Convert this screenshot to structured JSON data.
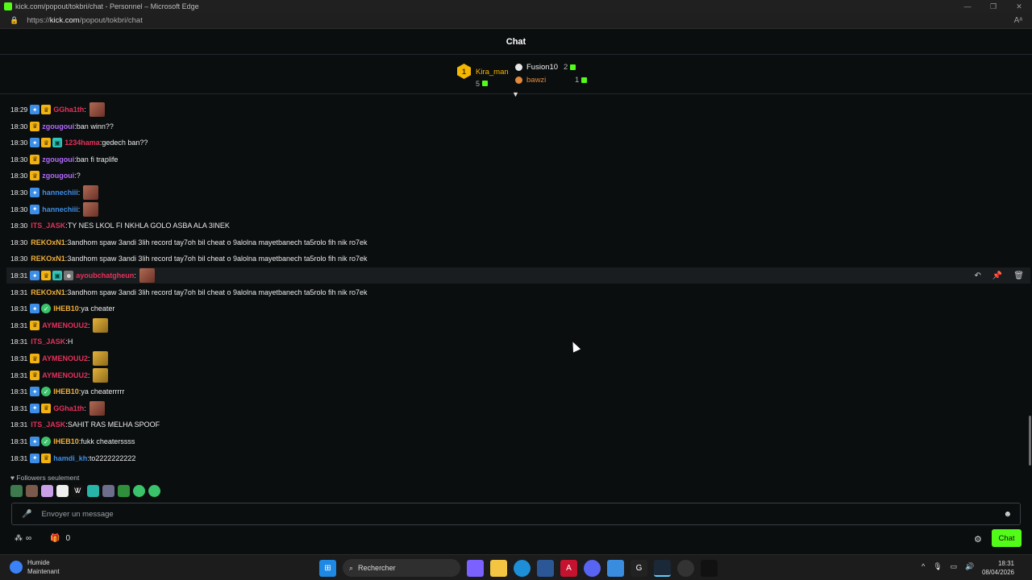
{
  "browser": {
    "title": "kick.com/popout/tokbri/chat - Personnel – Microsoft Edge",
    "url_prefix": "https://",
    "url_host": "kick.com",
    "url_path": "/popout/tokbri/chat"
  },
  "header": {
    "title": "Chat"
  },
  "leaderboard": {
    "first": {
      "rank": "1",
      "name": "Kira_man",
      "count": "5"
    },
    "second": {
      "name": "Fusion10",
      "count": "2"
    },
    "third": {
      "name": "bawzi",
      "count": "1"
    }
  },
  "messages": [
    {
      "time": "18:29",
      "badges": [
        "blue",
        "gold"
      ],
      "user": "GGha1th",
      "user_color": "#e5315b",
      "text": "",
      "emote": "red"
    },
    {
      "time": "18:30",
      "badges": [
        "gold"
      ],
      "user": "zgougoui",
      "user_color": "#b26bff",
      "text": "ban winn??",
      "emote": ""
    },
    {
      "time": "18:30",
      "badges": [
        "blue",
        "gold",
        "teal"
      ],
      "user": "1234hama",
      "user_color": "#e5315b",
      "text": "gedech ban??",
      "emote": ""
    },
    {
      "time": "18:30",
      "badges": [
        "gold"
      ],
      "user": "zgougoui",
      "user_color": "#b26bff",
      "text": "ban fi traplife",
      "emote": ""
    },
    {
      "time": "18:30",
      "badges": [
        "gold"
      ],
      "user": "zgougoui",
      "user_color": "#b26bff",
      "text": "?",
      "emote": ""
    },
    {
      "time": "18:30",
      "badges": [
        "blue"
      ],
      "user": "hannechiii",
      "user_color": "#3d8ee6",
      "text": "",
      "emote": "red"
    },
    {
      "time": "18:30",
      "badges": [
        "blue"
      ],
      "user": "hannechiii",
      "user_color": "#3d8ee6",
      "text": "",
      "emote": "red"
    },
    {
      "time": "18:30",
      "badges": [],
      "user": "ITS_JASK",
      "user_color": "#e5315b",
      "text": "TY NES LKOL FI NKHLA GOLO ASBA ALA 3INEK",
      "emote": ""
    },
    {
      "time": "18:30",
      "badges": [],
      "user": "REKOxN1",
      "user_color": "#f0b03c",
      "text": "3andhom spaw 3andi 3lih record tay7oh bil cheat o 9alolna mayetbanech ta5rolo fih nik ro7ek",
      "emote": ""
    },
    {
      "time": "18:30",
      "badges": [],
      "user": "REKOxN1",
      "user_color": "#f0b03c",
      "text": "3andhom spaw 3andi 3lih record tay7oh bil cheat o 9alolna mayetbanech ta5rolo fih nik ro7ek",
      "emote": ""
    },
    {
      "time": "18:31",
      "badges": [
        "blue",
        "gold",
        "teal",
        "gray"
      ],
      "user": "ayoubchatgheun",
      "user_color": "#e5315b",
      "text": "",
      "emote": "red",
      "highlight": true
    },
    {
      "time": "18:31",
      "badges": [],
      "user": "REKOxN1",
      "user_color": "#f0b03c",
      "text": "3andhom spaw 3andi 3lih record tay7oh bil cheat o 9alolna mayetbanech ta5rolo fih nik ro7ek",
      "emote": ""
    },
    {
      "time": "18:31",
      "badges": [
        "blue",
        "green"
      ],
      "user": "IHEB10",
      "user_color": "#f0b03c",
      "text": "ya cheater",
      "emote": ""
    },
    {
      "time": "18:31",
      "badges": [
        "gold"
      ],
      "user": "AYMENOUU2",
      "user_color": "#e5315b",
      "text": "",
      "emote": "yellow"
    },
    {
      "time": "18:31",
      "badges": [],
      "user": "ITS_JASK",
      "user_color": "#e5315b",
      "text": "H",
      "emote": ""
    },
    {
      "time": "18:31",
      "badges": [
        "gold"
      ],
      "user": "AYMENOUU2",
      "user_color": "#e5315b",
      "text": "",
      "emote": "yellow"
    },
    {
      "time": "18:31",
      "badges": [
        "gold"
      ],
      "user": "AYMENOUU2",
      "user_color": "#e5315b",
      "text": "",
      "emote": "yellow"
    },
    {
      "time": "18:31",
      "badges": [
        "blue",
        "green"
      ],
      "user": "IHEB10",
      "user_color": "#f0b03c",
      "text": "ya cheaterrrrr",
      "emote": ""
    },
    {
      "time": "18:31",
      "badges": [
        "blue",
        "gold"
      ],
      "user": "GGha1th",
      "user_color": "#e5315b",
      "text": "",
      "emote": "red"
    },
    {
      "time": "18:31",
      "badges": [],
      "user": "ITS_JASK",
      "user_color": "#e5315b",
      "text": "SAHIT RAS MELHA SPOOF",
      "emote": ""
    },
    {
      "time": "18:31",
      "badges": [
        "blue",
        "green"
      ],
      "user": "IHEB10",
      "user_color": "#f0b03c",
      "text": "fukk cheaterssss",
      "emote": ""
    },
    {
      "time": "18:31",
      "badges": [
        "blue",
        "gold"
      ],
      "user": "hamdi_kh",
      "user_color": "#3d8ee6",
      "text": "to2222222222",
      "emote": ""
    }
  ],
  "followers_label": "Followers seulement",
  "input": {
    "placeholder": "Envoyer un message"
  },
  "bottom": {
    "gift_count": "0",
    "chat_button": "Chat"
  },
  "taskbar": {
    "weather_title": "Humide",
    "weather_sub": "Maintenant",
    "search": "Rechercher",
    "time": "18:31",
    "date": "08/04/2026"
  }
}
